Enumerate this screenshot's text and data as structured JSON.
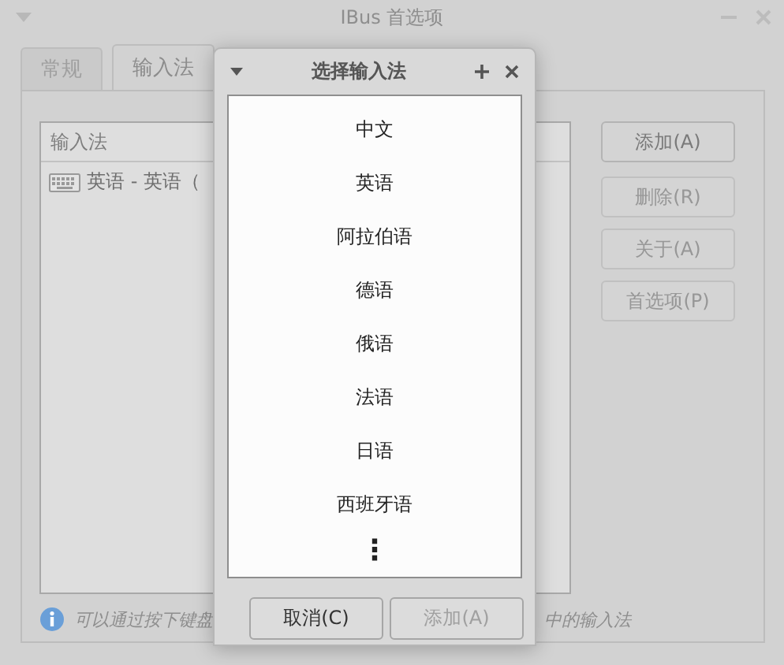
{
  "window": {
    "title": "IBus 首选项"
  },
  "tabs": [
    {
      "label": "常规",
      "selected": false
    },
    {
      "label": "输入法",
      "selected": true
    }
  ],
  "input_method_list": {
    "header": "输入法",
    "rows": [
      {
        "label": "英语 - 英语（"
      }
    ]
  },
  "buttons": [
    {
      "label": "添加(A)",
      "disabled": false
    },
    {
      "label": "删除(R)",
      "disabled": true
    },
    {
      "label": "关于(A)",
      "disabled": true
    },
    {
      "label": "首选项(P)",
      "disabled": true
    }
  ],
  "info": {
    "text_before": "可以通过按下键盘",
    "text_after": "中的输入法"
  },
  "dialog": {
    "title": "选择输入法",
    "items": [
      "中文",
      "英语",
      "阿拉伯语",
      "德语",
      "俄语",
      "法语",
      "日语",
      "西班牙语"
    ],
    "more": "⋮",
    "buttons": [
      {
        "label": "取消(C)",
        "disabled": false
      },
      {
        "label": "添加(A)",
        "disabled": true
      }
    ]
  }
}
